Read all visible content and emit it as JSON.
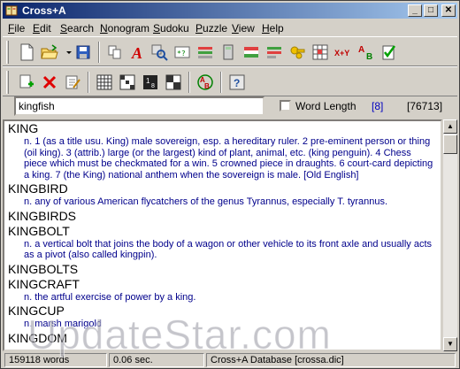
{
  "window": {
    "title": "Cross+A"
  },
  "titlebar_buttons": {
    "minimize": "_",
    "maximize": "□",
    "close": "✕"
  },
  "menu": [
    {
      "label": "File",
      "u": "F",
      "rest": "ile"
    },
    {
      "label": "Edit",
      "u": "E",
      "rest": "dit"
    },
    {
      "label": "Search",
      "u": "S",
      "rest": "earch"
    },
    {
      "label": "Nonogram",
      "u": "N",
      "rest": "onogram"
    },
    {
      "label": "Sudoku",
      "u": "S",
      "rest": "udoku"
    },
    {
      "label": "Puzzle",
      "u": "P",
      "rest": "uzzle"
    },
    {
      "label": "View",
      "u": "V",
      "rest": "iew"
    },
    {
      "label": "Help",
      "u": "H",
      "rest": "elp"
    }
  ],
  "toolbar1_icons": [
    "new-file-icon",
    "open-folder-icon",
    "save-icon",
    "copy-icon",
    "font-a-icon",
    "puzzle-search-icon",
    "regex-icon",
    "word-list-icon",
    "calculator-icon",
    "flag-icon",
    "lines-icon",
    "keys-icon",
    "grid-icon",
    "x-plus-y-icon",
    "ab-translate-icon",
    "check-list-icon"
  ],
  "toolbar2_icons": [
    "add-icon",
    "delete-icon",
    "edit-icon",
    "crossword-grid-icon",
    "sudoku-icon",
    "number-grid-icon",
    "nonogram-icon",
    "anagram-icon",
    "help-icon"
  ],
  "search": {
    "value": "kingfish",
    "word_length_label": "Word Length",
    "word_length_value": "[8]",
    "count": "[76713]"
  },
  "entries": [
    {
      "word": "KING",
      "def": "n. 1 (as a title usu. King) male sovereign, esp. a hereditary ruler. 2 pre-eminent person or thing (oil king). 3 (attrib.) large (or the largest) kind of plant, animal, etc. (king penguin). 4 Chess piece which must be checkmated for a win. 5 crowned piece in draughts. 6 court-card depicting a king. 7 (the King) national anthem when the sovereign is male. [Old English]"
    },
    {
      "word": "KINGBIRD",
      "def": "n. any of various American flycatchers of the genus Tyrannus, especially T. tyrannus."
    },
    {
      "word": "KINGBIRDS",
      "def": ""
    },
    {
      "word": "KINGBOLT",
      "def": "n. a vertical bolt that joins the body of a wagon or other vehicle to its front axle and usually acts as a pivot (also called kingpin)."
    },
    {
      "word": "KINGBOLTS",
      "def": ""
    },
    {
      "word": "KINGCRAFT",
      "def": "n. the artful exercise of power by a king."
    },
    {
      "word": "KINGCUP",
      "def": "n. marsh marigold"
    },
    {
      "word": "KINGDOM",
      "def": ""
    }
  ],
  "status": {
    "words": "159118 words",
    "time": "0.06 sec.",
    "database": "Cross+A Database [crossa.dic]"
  },
  "watermark": "UpdateStar.com"
}
